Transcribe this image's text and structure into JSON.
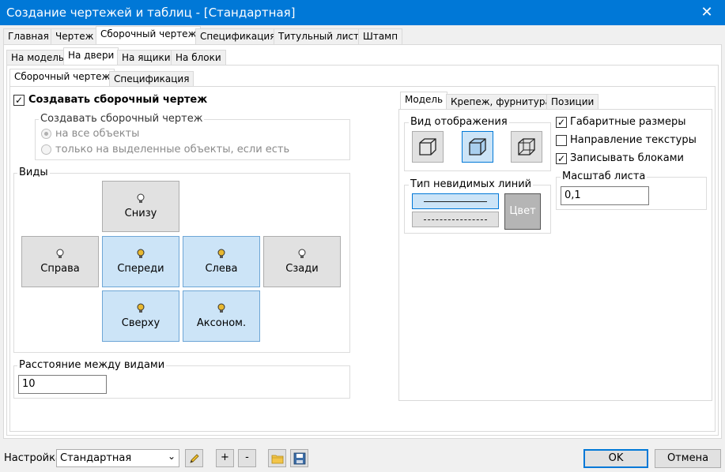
{
  "window": {
    "title": "Создание чертежей и таблиц - [Стандартная]"
  },
  "main_tabs": [
    "Главная",
    "Чертеж",
    "Сборочный чертеж",
    "Спецификация",
    "Титульный лист",
    "Штамп"
  ],
  "sub_tabs": [
    "На модель",
    "На двери",
    "На ящики",
    "На блоки"
  ],
  "inner_tabs": [
    "Сборочный чертеж",
    "Спецификация"
  ],
  "left": {
    "create_assembly": {
      "label": "Создавать сборочный чертеж",
      "checked": true
    },
    "create_group": {
      "title": "Создавать сборочный чертеж",
      "option_all": "на все объекты",
      "option_selected": "только на выделенные объекты, если есть"
    },
    "views": {
      "title": "Виды",
      "bottom": "Снизу",
      "right": "Справа",
      "front": "Спереди",
      "left": "Слева",
      "back": "Сзади",
      "top": "Сверху",
      "axon": "Аксоном."
    },
    "distance": {
      "title": "Расстояние между видами",
      "value": "10"
    }
  },
  "right": {
    "tabs": [
      "Модель",
      "Крепеж, фурнитура",
      "Позиции"
    ],
    "display_group": "Вид отображения",
    "hidden_lines_group": "Тип невидимых линий",
    "color_button": "Цвет",
    "checkboxes": {
      "overall_dims": "Габаритные размеры",
      "texture_dir": "Направление текстуры",
      "write_blocks": "Записывать блоками"
    },
    "scale": {
      "title": "Масштаб листа",
      "value": "0,1"
    }
  },
  "footer": {
    "settings_label": "Настройка",
    "preset": "Стандартная",
    "plus": "+",
    "minus": "-",
    "ok": "OK",
    "cancel": "Отмена"
  },
  "colors": {
    "titlebar": "#0078d7",
    "selected": "#cce4f7",
    "bulb": "#e8b830"
  }
}
